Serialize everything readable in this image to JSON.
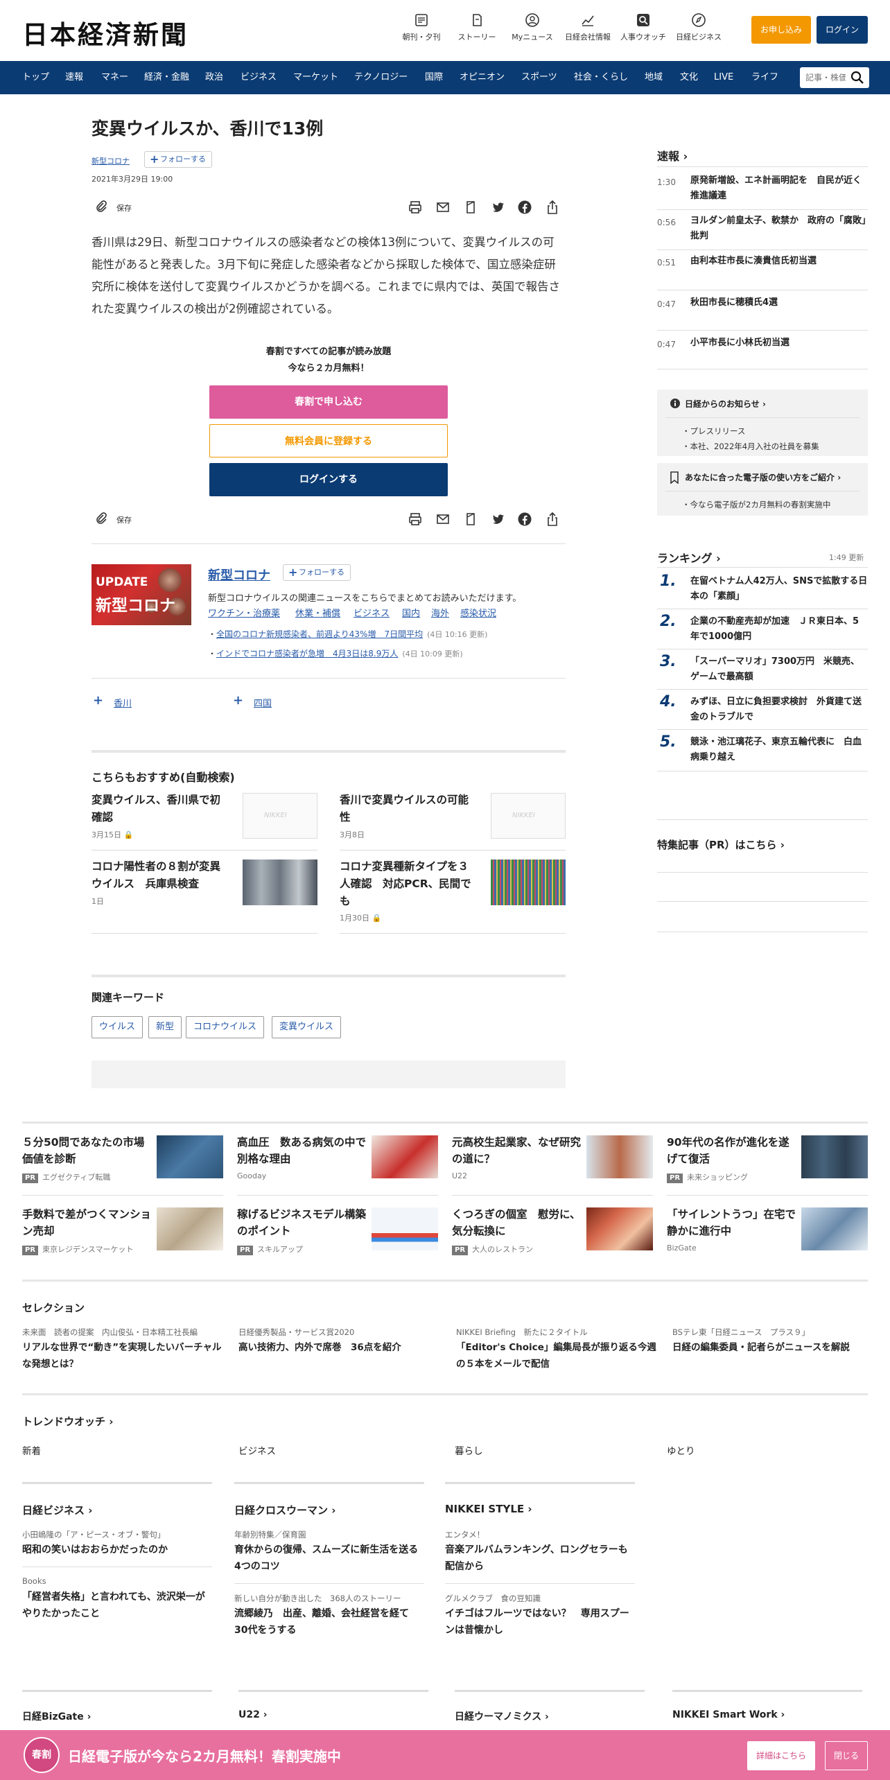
{
  "header": {
    "logo": "日本経済新聞",
    "icons": [
      {
        "label": "朝刊・夕刊",
        "icon": "newspaper-icon"
      },
      {
        "label": "ストーリー",
        "icon": "story-icon"
      },
      {
        "label": "Myニュース",
        "icon": "user-icon"
      },
      {
        "label": "日経会社情報",
        "icon": "chart-icon"
      },
      {
        "label": "人事ウオッチ",
        "icon": "search-person-icon"
      },
      {
        "label": "日経ビジネス",
        "icon": "compass-icon"
      }
    ],
    "apply_label": "お申し込み",
    "login_label": "ログイン",
    "accent_orange": "#f39800",
    "brand_navy": "#0b3b73"
  },
  "nav": {
    "items": [
      "トップ",
      "速報",
      "マネー",
      "経済・金融",
      "政治",
      "ビジネス",
      "マーケット",
      "テクノロジー",
      "国際",
      "オピニオン",
      "スポーツ",
      "社会・くらし",
      "地域",
      "文化",
      "LIVE",
      "ライフ"
    ],
    "search_placeholder": "記事・株価検索"
  },
  "article": {
    "title": "変異ウイルスか、香川で13例",
    "topic": "新型コロナ",
    "follow_label": "フォローする",
    "date": "2021年3月29日 19:00",
    "save_label": "保存",
    "body": "香川県は29日、新型コロナウイルスの感染者などの検体13例について、変異ウイルスの可能性があると発表した。3月下旬に発症した感染者などから採取した検体で、国立感染症研究所に検体を送付して変異ウイルスかどうかを調べる。これまでに県内では、英国で報告された変異ウイルスの検出が2例確認されている。",
    "promo": {
      "line1": "春割ですべての記事が読み放題",
      "line2": "今なら２カ月無料！",
      "btn_subscribe": "春割で申し込む",
      "btn_register": "無料会員に登録する",
      "btn_login": "ログインする"
    }
  },
  "topic_box": {
    "img_update": "UPDATE",
    "img_text": "新型コロナ",
    "name": "新型コロナ",
    "follow_label": "フォローする",
    "desc": "新型コロナウイルスの関連ニュースをこちらでまとめてお読みいただけます。",
    "tags": [
      "ワクチン・治療薬",
      "休業・補償",
      "ビジネス",
      "国内",
      "海外",
      "感染状況"
    ],
    "news": [
      {
        "title": "全国のコロナ新規感染者、前週より43%増　7日間平均",
        "time": "(4日 10:16 更新)"
      },
      {
        "title": "インドでコロナ感染者が急増　4月3日は8.9万人",
        "time": "(4日 10:09 更新)"
      }
    ]
  },
  "regions": [
    "香川",
    "四国"
  ],
  "recommend": {
    "heading": "こちらもおすすめ(自動検索)",
    "items": [
      {
        "title": "変異ウイルス、香川県で初確認",
        "date": "3月15日",
        "locked": true
      },
      {
        "title": "香川で変異ウイルスの可能性",
        "date": "3月8日",
        "locked": false
      },
      {
        "title": "コロナ陽性者の８割が変異ウイルス　兵庫県検査",
        "date": "1日",
        "locked": false
      },
      {
        "title": "コロナ変異種新タイプを３人確認　対応PCR、民間でも",
        "date": "1月30日",
        "locked": true
      }
    ],
    "placeholder": "NIKKEI"
  },
  "keywords": {
    "heading": "関連キーワード",
    "items": [
      "ウイルス",
      "新型",
      "コロナウイルス",
      "変異ウイルス"
    ]
  },
  "sidebar": {
    "flash_heading": "速報",
    "flash": [
      {
        "time": "1:30",
        "title": "原発新増設、エネ計画明記を　自民が近く推進議連"
      },
      {
        "time": "0:56",
        "title": "ヨルダン前皇太子、軟禁か　政府の「腐敗」批判"
      },
      {
        "time": "0:51",
        "title": "由利本荘市長に湊貴信氏初当選"
      },
      {
        "time": "0:47",
        "title": "秋田市長に穂積氏4選"
      },
      {
        "time": "0:47",
        "title": "小平市長に小林氏初当選"
      }
    ],
    "notice1": {
      "heading": "日経からのお知らせ",
      "items": [
        "プレスリリース",
        "本社、2022年4月入社の社員を募集"
      ]
    },
    "notice2": {
      "heading": "あなたに合った電子版の使い方をご紹介",
      "items": [
        "今なら電子版が2カ月無料の春割実施中"
      ]
    },
    "ranking_heading": "ランキング",
    "ranking_time": "1:49 更新",
    "ranking": [
      {
        "num": "1.",
        "title": "在留ベトナム人42万人、SNSで拡散する日本の「素顔」"
      },
      {
        "num": "2.",
        "title": "企業の不動産売却が加速　ＪＲ東日本、5年で1000億円"
      },
      {
        "num": "3.",
        "title": "「スーパーマリオ」7300万円　米競売、ゲームで最高額"
      },
      {
        "num": "4.",
        "title": "みずほ、日立に負担要求検討　外貨建て送金のトラブルで"
      },
      {
        "num": "5.",
        "title": "競泳・池江璃花子、東京五輪代表に　白血病乗り越え"
      }
    ],
    "special_heading": "特集記事（PR）はこちら"
  },
  "ads": [
    {
      "title": "５分50問であなたの市場価値を診断",
      "sponsor": "エグゼクティブ転職",
      "pr": true
    },
    {
      "title": "高血圧　数ある病気の中で別格な理由",
      "sponsor": "Gooday",
      "pr": false
    },
    {
      "title": "元高校生起業家、なぜ研究の道に？",
      "sponsor": "U22",
      "pr": false
    },
    {
      "title": "90年代の名作が進化を遂げて復活",
      "sponsor": "未来ショッピング",
      "pr": true
    },
    {
      "title": "手数料で差がつくマンション売却",
      "sponsor": "東京レジデンスマーケット",
      "pr": true
    },
    {
      "title": "稼げるビジネスモデル構築のポイント",
      "sponsor": "スキルアップ",
      "pr": true
    },
    {
      "title": "くつろぎの個室　慰労に、気分転換に",
      "sponsor": "大人のレストラン",
      "pr": true
    },
    {
      "title": "「サイレントうつ」在宅で静かに進行中",
      "sponsor": "BizGate",
      "pr": false
    }
  ],
  "selection": {
    "heading": "セレクション",
    "items": [
      {
        "sub": "未来面　読者の提案　内山俊弘・日本精工社長編",
        "title": "リアルな世界で“動き”を実現したいバーチャルな発想とは？"
      },
      {
        "sub": "日経優秀製品・サービス賞2020",
        "title": "高い技術力、内外で席巻　36点を紹介"
      },
      {
        "sub": "NIKKEI Briefing　新たに２タイトル",
        "title": "「Editor's Choice」編集局長が振り返る今週の５本をメールで配信"
      },
      {
        "sub": "BSテレ東「日経ニュース　プラス９」",
        "title": "日経の編集委員・記者らがニュースを解説"
      }
    ]
  },
  "trend": {
    "heading": "トレンドウオッチ",
    "items": [
      "新着",
      "ビジネス",
      "暮らし",
      "ゆとり"
    ]
  },
  "media": [
    {
      "heading": "日経ビジネス",
      "items": [
        {
          "sub": "小田嶋隆の「ア・ピース・オブ・警句」",
          "title": "昭和の笑いはおおらかだったのか"
        },
        {
          "sub": "Books",
          "title": "「経営者失格」と言われても、渋沢栄一がやりたかったこと"
        }
      ]
    },
    {
      "heading": "日経クロスウーマン",
      "items": [
        {
          "sub": "年齢別特集／保育園",
          "title": "育休からの復帰、スムーズに新生活を送る4つのコツ"
        },
        {
          "sub": "新しい自分が動き出した　368人のストーリー",
          "title": "流郷綾乃　出産、離婚、会社経営を経て30代をうする"
        }
      ]
    },
    {
      "heading": "NIKKEI STYLE",
      "items": [
        {
          "sub": "エンタメ！",
          "title": "音楽アルバムランキング、ロングセラーも配信から"
        },
        {
          "sub": "グルメクラブ　食の豆知識",
          "title": "イチゴはフルーツではない？　専用スプーンは昔懐かし"
        }
      ]
    }
  ],
  "bottom_links": [
    "日経BizGate",
    "U22",
    "日経ウーマノミクス",
    "NIKKEI Smart Work"
  ],
  "banner": {
    "badge": "春割",
    "text": "日経電子版が今なら2カ月無料！春割実施中",
    "details_label": "詳細はこちら",
    "close_label": "閉じる",
    "color": "#e8709f"
  }
}
